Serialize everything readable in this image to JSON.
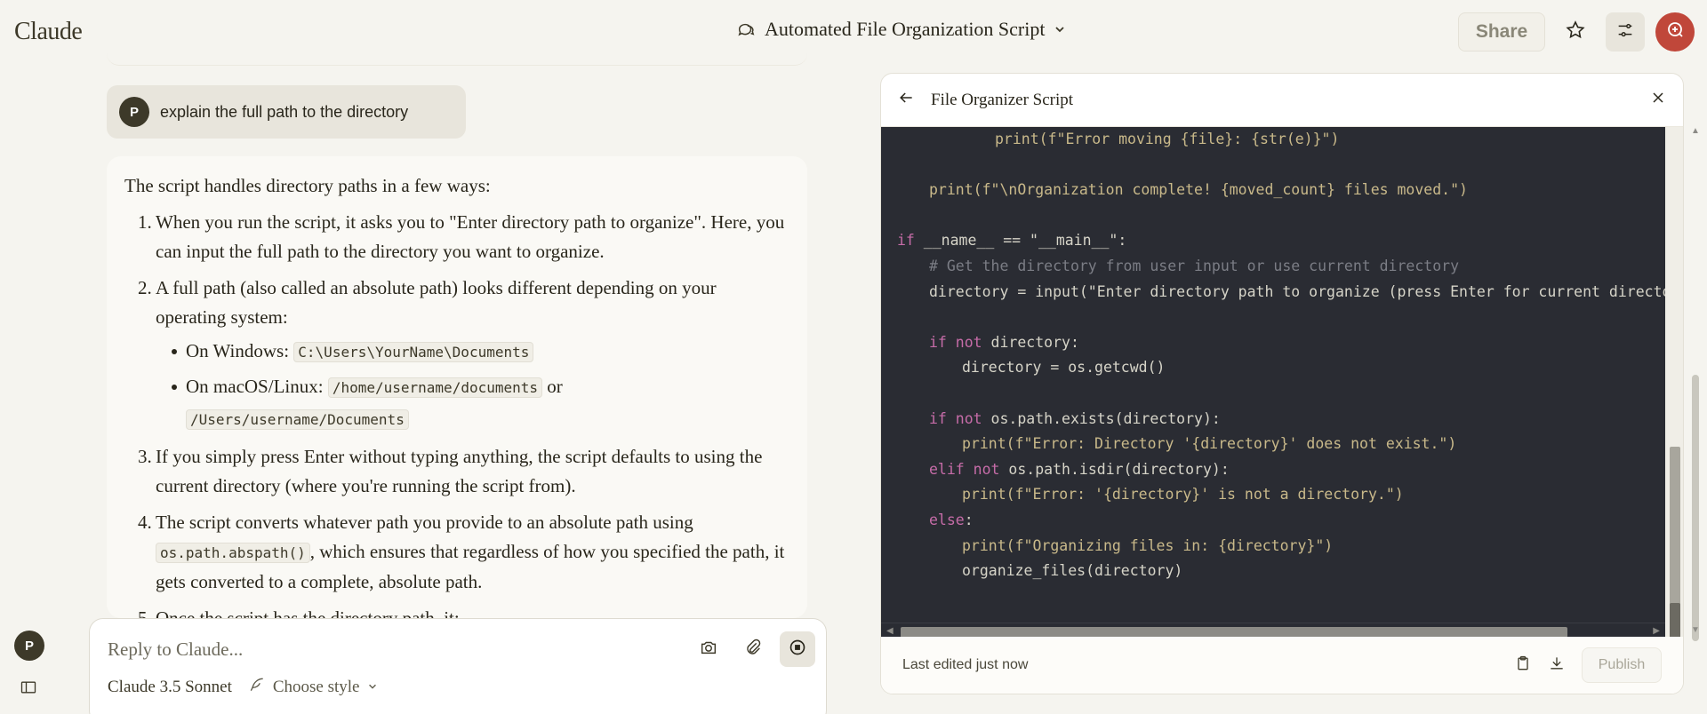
{
  "app": {
    "logo": "Claude",
    "conversation_title": "Automated File Organization Script",
    "share_label": "Share",
    "user_initial": "P"
  },
  "colors": {
    "background": "#f5f4ef",
    "code_bg": "#2a2c33",
    "keyword": "#c66ca8",
    "avatar_accent": "#c0473a"
  },
  "icons": {
    "title": "chat-bubbles-icon",
    "title_caret": "chevron-down-icon",
    "star": "star-icon",
    "settings": "sliders-icon",
    "profile": "chat-search-icon"
  },
  "user_message": {
    "text": "explain the full path to the directory"
  },
  "assistant": {
    "intro": "The script handles directory paths in a few ways:",
    "steps": [
      {
        "num": "1.",
        "text": "When you run the script, it asks you to \"Enter directory path to organize\". Here, you can input the full path to the directory you want to organize."
      },
      {
        "num": "2.",
        "text": "A full path (also called an absolute path) looks different depending on your operating system:",
        "sub": [
          {
            "label": "On Windows:",
            "code": "C:\\Users\\YourName\\Documents"
          },
          {
            "label": "On macOS/Linux:",
            "code": "/home/username/documents",
            "or": "or",
            "code2": "/Users/username/Documents"
          }
        ]
      },
      {
        "num": "3.",
        "text": "If you simply press Enter without typing anything, the script defaults to using the current directory (where you're running the script from)."
      },
      {
        "num": "4.",
        "pre": "The script converts whatever path you provide to an absolute path using",
        "code": "os.path.abspath()",
        "post": ", which ensures that regardless of how you specified the path, it gets converted to a complete, absolute path."
      },
      {
        "num": "5.",
        "text": "Once the script has the directory path, it:"
      }
    ]
  },
  "reply": {
    "placeholder": "Reply to Claude...",
    "model": "Claude 3.5 Sonnet",
    "style": "Choose style"
  },
  "artifact": {
    "title": "File Organizer Script",
    "footer_status": "Last edited just now",
    "publish_label": "Publish",
    "code": {
      "l1": "print(f\"Error moving {file}: {str(e)}\")",
      "l3": "print(f\"\\nOrganization complete! {moved_count} files moved.\")",
      "l5_kw1": "if",
      "l5_rest": " __name__ == \"__main__\":",
      "l6": "# Get the directory from user input or use current directory",
      "l7": "directory = input(\"Enter directory path to organize (press Enter for current directory): \")",
      "l9_kw": "if not",
      "l9_rest": " directory:",
      "l10": "directory = os.getcwd()",
      "l12_kw": "if not",
      "l12_rest": " os.path.exists(directory):",
      "l13": "print(f\"Error: Directory '{directory}' does not exist.\")",
      "l14_kw": "elif not",
      "l14_rest": " os.path.isdir(directory):",
      "l15": "print(f\"Error: '{directory}' is not a directory.\")",
      "l16_kw": "else",
      "l16_rest": ":",
      "l17": "print(f\"Organizing files in: {directory}\")",
      "l18": "organize_files(directory)"
    }
  }
}
